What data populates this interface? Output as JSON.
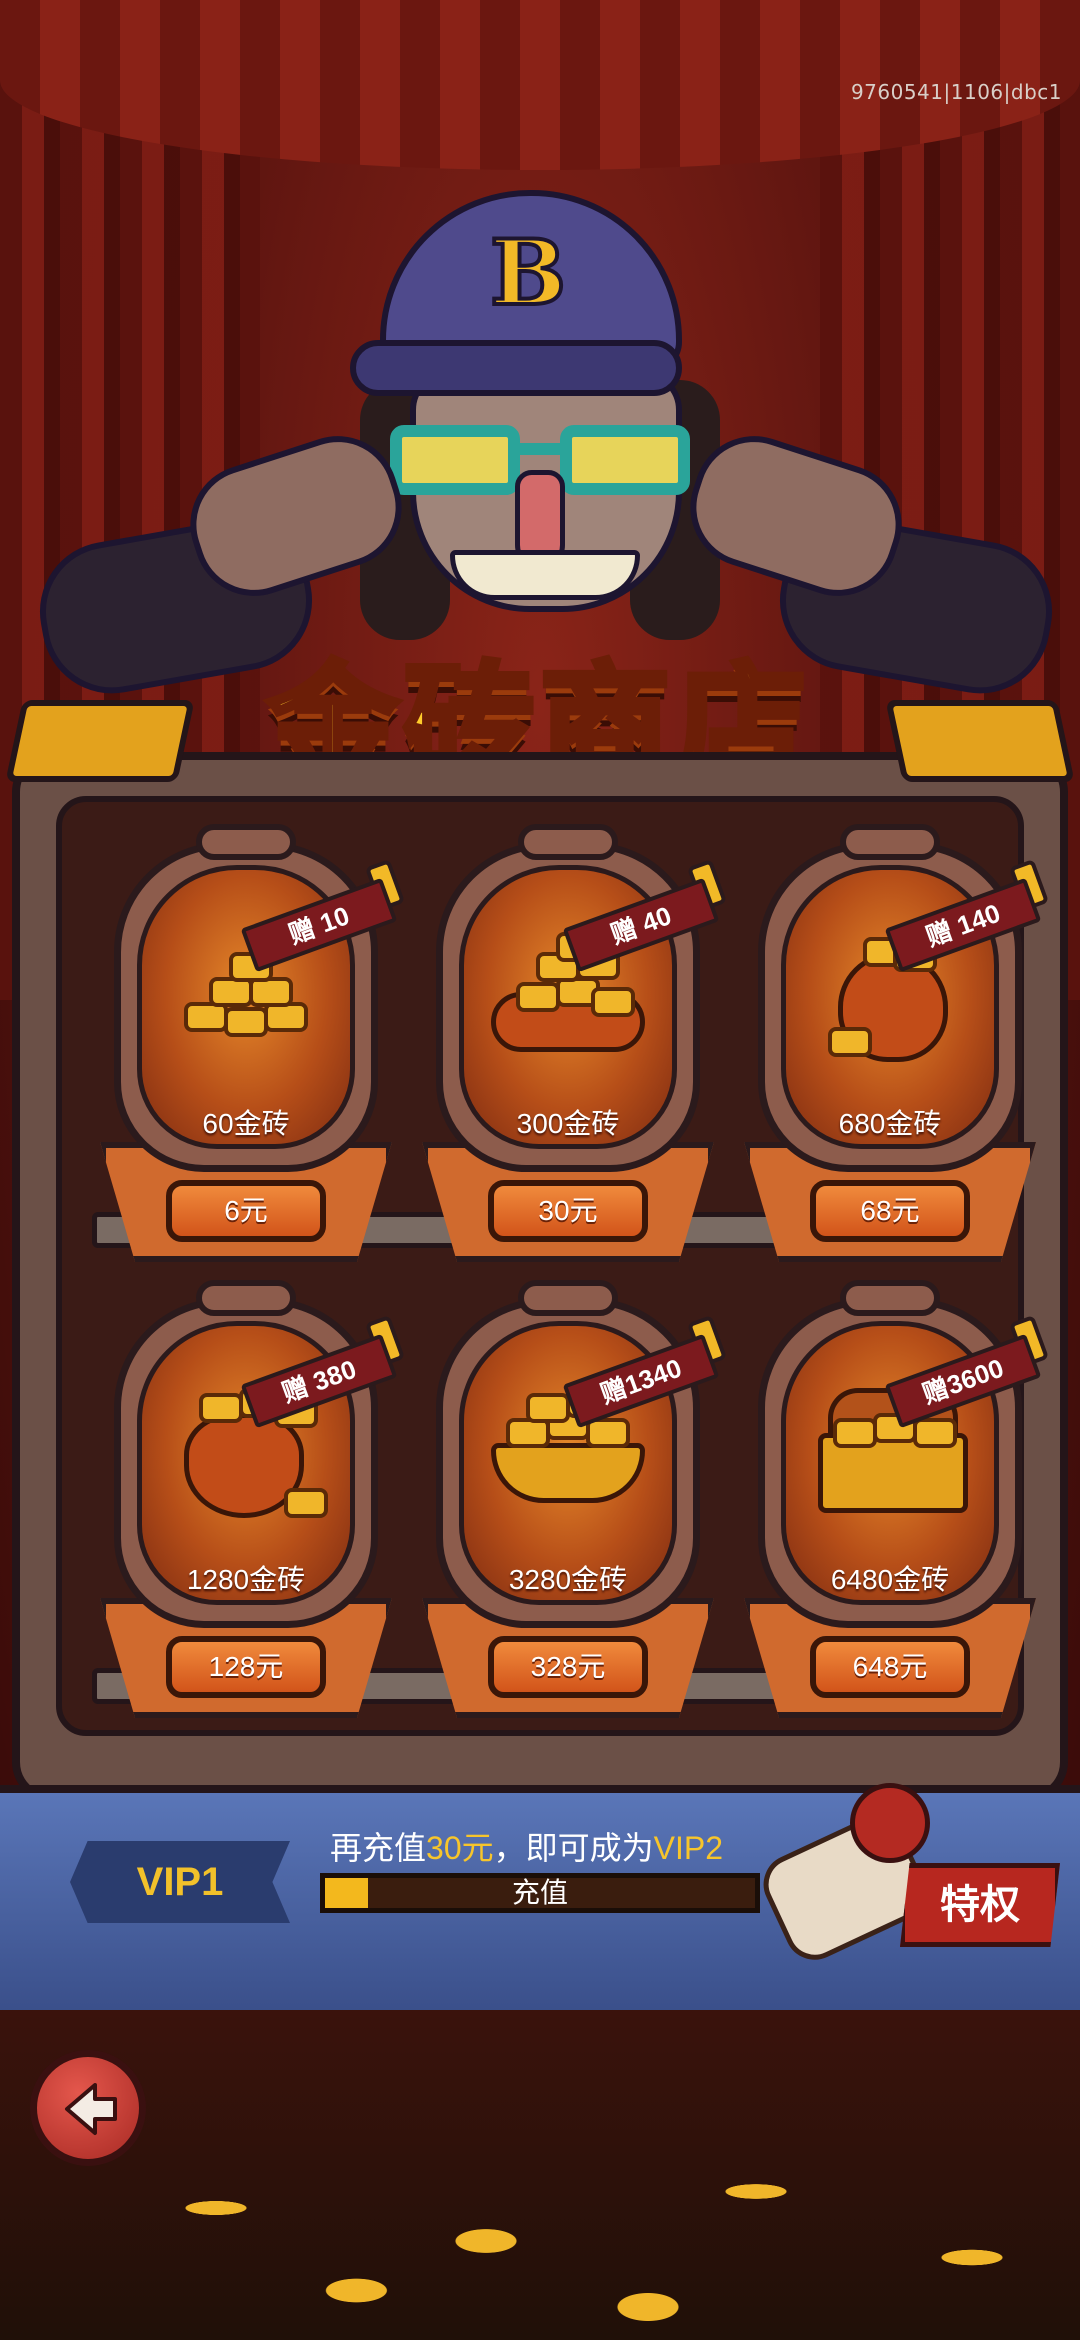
{
  "build_id": "9760541|1106|dbc1",
  "title": "金砖商店",
  "products": [
    {
      "amount": "60金砖",
      "bonus": "赠 10",
      "price": "6元",
      "illus": "gold-pile-icon"
    },
    {
      "amount": "300金砖",
      "bonus": "赠 40",
      "price": "30元",
      "illus": "gold-cushion-icon"
    },
    {
      "amount": "680金砖",
      "bonus": "赠 140",
      "price": "68元",
      "illus": "gold-sack-icon"
    },
    {
      "amount": "1280金砖",
      "bonus": "赠 380",
      "price": "128元",
      "illus": "gold-purse-icon"
    },
    {
      "amount": "3280金砖",
      "bonus": "赠1340",
      "price": "328元",
      "illus": "gold-bowl-icon"
    },
    {
      "amount": "6480金砖",
      "bonus": "赠3600",
      "price": "648元",
      "illus": "gold-chest-icon"
    }
  ],
  "vip": {
    "level": "VIP1",
    "text_prefix": "再充值",
    "text_amount": "30元",
    "text_middle": "，即可成为",
    "text_next": "VIP2",
    "progress_label": "充值",
    "progress": 0.1,
    "privilege_label": "特权"
  },
  "colors": {
    "gold": "#f0b62a",
    "title": "#ffcc2b",
    "price_button": "#e0652a",
    "vip_panel": "#4a62a0",
    "privilege": "#b7271f"
  },
  "icons": {
    "back": "back-arrow-icon",
    "privilege": "scroll-seal-icon"
  }
}
